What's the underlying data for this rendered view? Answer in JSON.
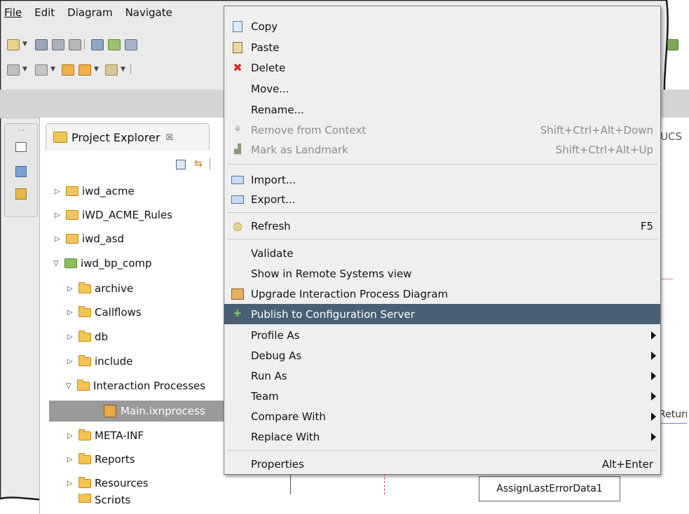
{
  "menubar": {
    "items": [
      "File",
      "Edit",
      "Diagram",
      "Navigate"
    ]
  },
  "explorer": {
    "tab_title": "Project Explorer",
    "tab_close": "☒",
    "tree": [
      {
        "label": "iwd_acme",
        "expanded": false
      },
      {
        "label": "iWD_ACME_Rules",
        "expanded": false
      },
      {
        "label": "iwd_asd",
        "expanded": false
      },
      {
        "label": "iwd_bp_comp",
        "expanded": true
      },
      {
        "label": "archive",
        "expanded": false
      },
      {
        "label": "Callflows",
        "expanded": false
      },
      {
        "label": "db",
        "expanded": false
      },
      {
        "label": "include",
        "expanded": false
      },
      {
        "label": "Interaction Processes",
        "expanded": true
      },
      {
        "label": "Main.ixnprocess",
        "selected": true
      },
      {
        "label": "META-INF",
        "expanded": false
      },
      {
        "label": "Reports",
        "expanded": false
      },
      {
        "label": "Resources",
        "expanded": false
      },
      {
        "label": "Scripts",
        "expanded": false
      }
    ]
  },
  "editor": {
    "ucs_label": "UCS",
    "return_label": "Return",
    "node_label": "AssignLastErrorData1"
  },
  "context_menu": {
    "items": [
      {
        "label": "Copy",
        "icon": "copy-icon"
      },
      {
        "label": "Paste",
        "icon": "paste-icon"
      },
      {
        "label": "Delete",
        "icon": "delete-icon"
      },
      {
        "label": "Move..."
      },
      {
        "label": "Rename..."
      },
      {
        "label": "Remove from Context",
        "shortcut": "Shift+Ctrl+Alt+Down",
        "disabled": true,
        "icon": "remove-context-icon"
      },
      {
        "label": "Mark as Landmark",
        "shortcut": "Shift+Ctrl+Alt+Up",
        "disabled": true,
        "icon": "landmark-icon"
      },
      {
        "label": "Import...",
        "icon": "import-icon"
      },
      {
        "label": "Export...",
        "icon": "export-icon"
      },
      {
        "label": "Refresh",
        "shortcut": "F5",
        "icon": "refresh-icon"
      },
      {
        "label": "Validate"
      },
      {
        "label": "Show in Remote Systems view"
      },
      {
        "label": "Upgrade Interaction Process Diagram",
        "icon": "upgrade-icon"
      },
      {
        "label": "Publish to Configuration Server",
        "icon": "publish-icon",
        "highlighted": true
      },
      {
        "label": "Profile As",
        "submenu": true
      },
      {
        "label": "Debug As",
        "submenu": true
      },
      {
        "label": "Run As",
        "submenu": true
      },
      {
        "label": "Team",
        "submenu": true
      },
      {
        "label": "Compare With",
        "submenu": true
      },
      {
        "label": "Replace With",
        "submenu": true
      },
      {
        "label": "Properties",
        "shortcut": "Alt+Enter"
      }
    ]
  },
  "colors": {
    "highlight": "#4a5f73",
    "menu_bg": "#efefef",
    "selection": "#9a9a9a",
    "delete_red": "#d8281e"
  }
}
